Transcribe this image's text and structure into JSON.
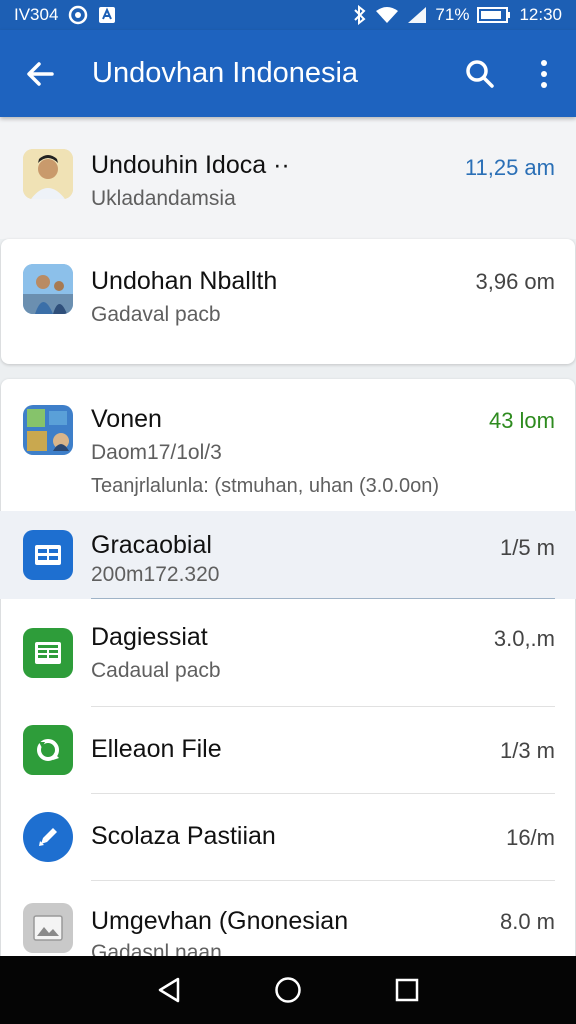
{
  "status_bar": {
    "left_text": "IV304",
    "battery": "71%",
    "time": "12:30"
  },
  "app_bar": {
    "title": "Undovhan Indonesia"
  },
  "items": [
    {
      "title": "Undouhin Idoca ··",
      "subtitle": "Ukladandamsia",
      "time": "11,25 am",
      "time_color": "#2a6fb6"
    },
    {
      "title": "Undohan Nballth",
      "subtitle": "Gadaval pacb",
      "time": "3,96 om"
    },
    {
      "title": "Vonen",
      "subtitle": "Daom17/1ol/3",
      "detail": "Teanjrlalunla: (stmuhan, uhan (3.0.0on)",
      "time": "43 lom",
      "time_color": "#2e8b1f"
    },
    {
      "title": "Gracaobial",
      "subtitle": "200m172.320",
      "time": "1/5 m"
    },
    {
      "title": "Dagiessiat",
      "subtitle": "Cadaual pacb",
      "time": "3.0,.m"
    },
    {
      "title": "Elleaon File",
      "time": "1/3 m"
    },
    {
      "title": "Scolaza Pastiian",
      "time": "16/m"
    },
    {
      "title": "Umgevhan (Gnonesian",
      "subtitle": "Gadasnl naan",
      "time": "8.0 m"
    }
  ],
  "colors": {
    "app_bar": "#1e63bf",
    "status_bar": "#1d5fb4",
    "doc_icon": "#1e6fd0",
    "sheet_icon": "#2e9d3a",
    "green_icon": "#2e9d3a",
    "blue_icon": "#1e6fd0"
  }
}
